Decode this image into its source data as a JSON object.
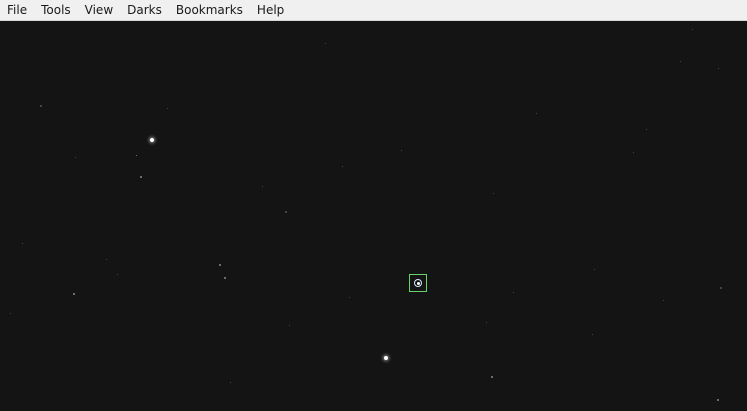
{
  "menubar": {
    "items": [
      "File",
      "Tools",
      "View",
      "Darks",
      "Bookmarks",
      "Help"
    ]
  },
  "colors": {
    "canvas_background": "#141414",
    "guide_box": "#67d36a"
  }
}
